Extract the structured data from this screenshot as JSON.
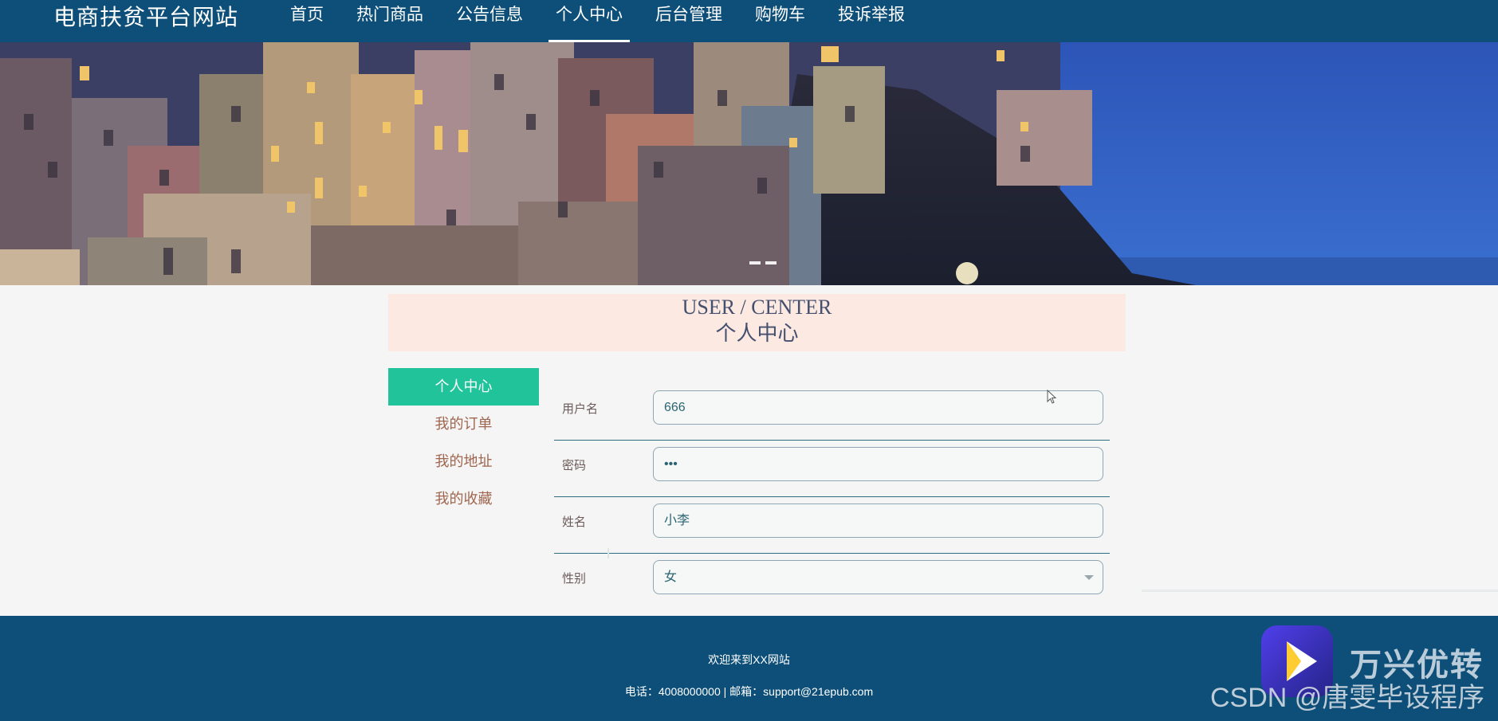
{
  "header": {
    "brand": "电商扶贫平台网站",
    "nav": [
      {
        "label": "首页"
      },
      {
        "label": "热门商品"
      },
      {
        "label": "公告信息"
      },
      {
        "label": "个人中心",
        "active": true
      },
      {
        "label": "后台管理"
      },
      {
        "label": "购物车"
      },
      {
        "label": "投诉举报"
      }
    ]
  },
  "banner": {
    "slide_count": 2,
    "active_slide": 1
  },
  "section": {
    "title_en": "USER / CENTER",
    "title_cn": "个人中心"
  },
  "sidebar": {
    "items": [
      {
        "label": "个人中心",
        "active": true
      },
      {
        "label": "我的订单"
      },
      {
        "label": "我的地址"
      },
      {
        "label": "我的收藏"
      }
    ]
  },
  "form": {
    "fields": [
      {
        "label": "用户名",
        "value": "666"
      },
      {
        "label": "密码",
        "value": "•••"
      },
      {
        "label": "姓名",
        "value": "小李"
      },
      {
        "label": "性别",
        "value": "女"
      }
    ]
  },
  "footer": {
    "welcome": "欢迎来到XX网站",
    "contact": "电话：4008000000 | 邮箱：support@21epub.com"
  },
  "watermarks": {
    "brand": "万兴优转",
    "csdn": "CSDN @唐雯毕设程序"
  },
  "colors": {
    "nav_bg": "#0d4f78",
    "accent": "#21c39b",
    "title_bg": "#fbe9e2",
    "sidebar_text": "#a06650"
  }
}
